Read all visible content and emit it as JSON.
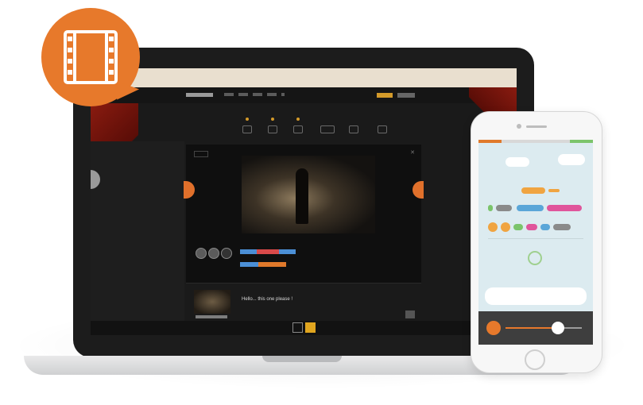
{
  "illustration": {
    "badge_icon": "film-strip-icon",
    "colors": {
      "accent": "#e7792b",
      "laptop_bezel": "#1c1c1c",
      "curtain": "#8a1b10",
      "phone_screen": "#dcebf0"
    }
  },
  "laptop_screen": {
    "subtitle_text": "Hello... this one please !"
  },
  "phone_screen": {
    "player_progress": 0.69
  }
}
